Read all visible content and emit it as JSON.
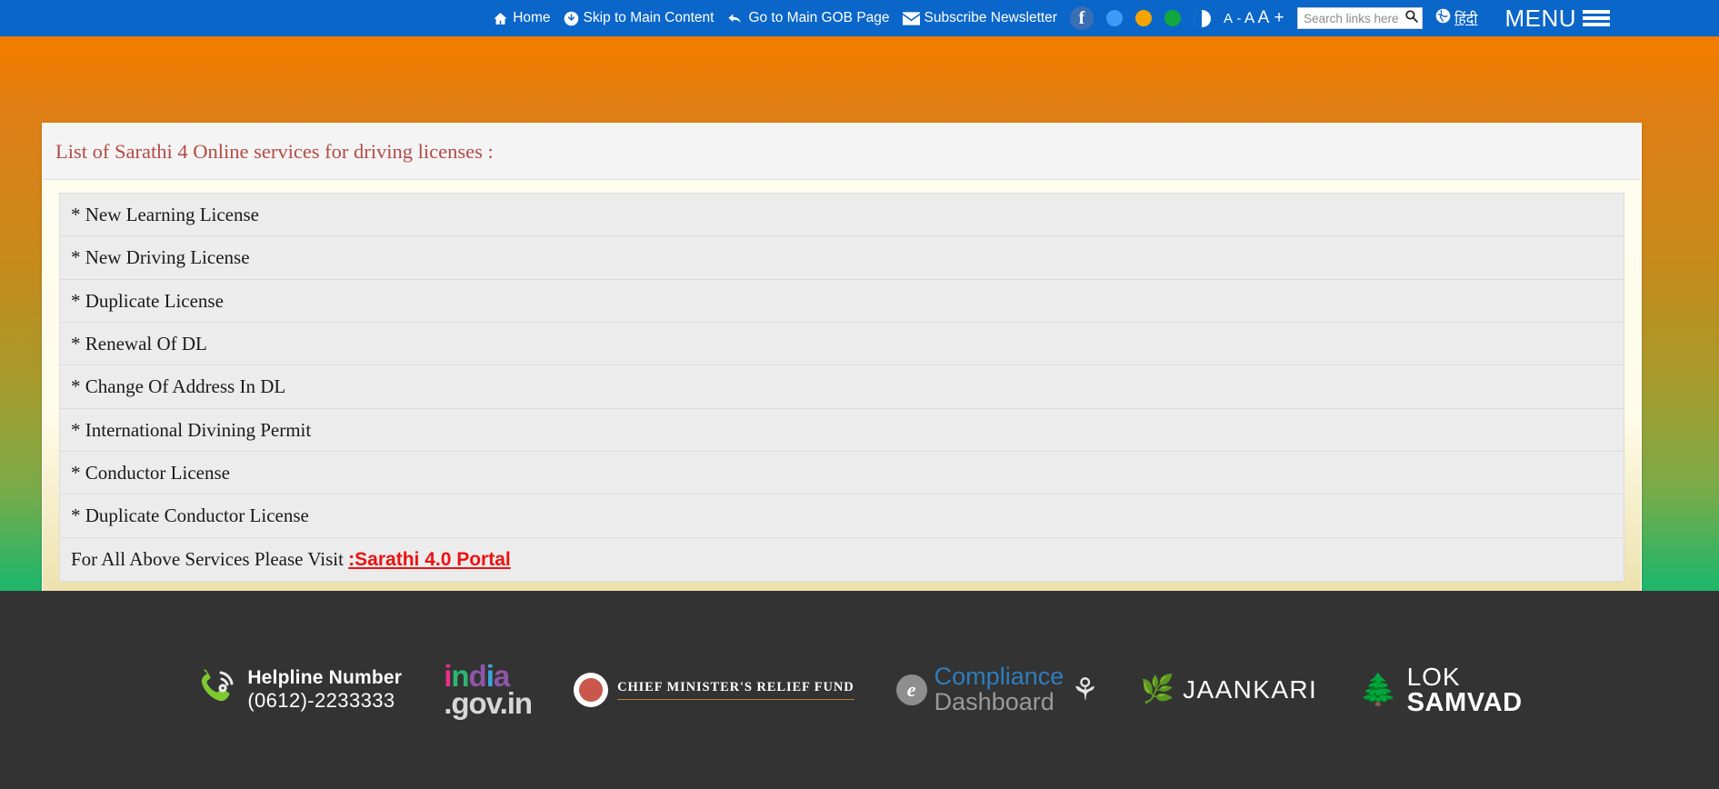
{
  "topbar": {
    "links": [
      {
        "label": "Home",
        "icon": "home-icon"
      },
      {
        "label": "Skip to Main Content",
        "icon": "skip-down-icon"
      },
      {
        "label": "Go to Main GOB Page",
        "icon": "back-arrow-icon"
      },
      {
        "label": "Subscribe Newsletter",
        "icon": "envelope-icon"
      }
    ],
    "facebook_label": "f",
    "theme_dots": [
      {
        "name": "blue",
        "color": "#3d9bf7"
      },
      {
        "name": "orange",
        "color": "#f7a400"
      },
      {
        "name": "green",
        "color": "#12a83d"
      }
    ],
    "contrast_icon": "contrast-icon",
    "font_decrease": "A -",
    "font_normal": "A",
    "font_increase": "A +",
    "search": {
      "placeholder": "Search links here",
      "value": "",
      "icon": "search-icon"
    },
    "language": {
      "label": "हिंदी",
      "icon": "globe-icon"
    },
    "menu": {
      "label": "MENU",
      "icon": "hamburger-icon"
    }
  },
  "panel": {
    "title": "List of Sarathi 4 Online services for driving licenses :",
    "services": [
      "* New Learning License",
      "* New Driving License",
      "* Duplicate License",
      "* Renewal Of DL",
      "* Change Of Address In DL",
      "* International Divining Permit",
      "* Conductor License",
      "* Duplicate Conductor License"
    ],
    "footer_note_prefix": "For All Above Services Please Visit ",
    "footer_note_link": ":Sarathi 4.0 Portal"
  },
  "footer": {
    "helpline": {
      "title": "Helpline Number",
      "number": "(0612)-2233333",
      "icon": "phone-icon"
    },
    "india_gov": {
      "part1": "i",
      "part2": "n",
      "part3": "d",
      "part4": "i",
      "part5": "a",
      "bottom": ".gov.in"
    },
    "cmrf": {
      "name": "CHIEF MINISTER'S RELIEF FUND",
      "icon": "cmrf-seal-icon"
    },
    "compliance": {
      "e": "e",
      "line1": "Compliance",
      "line2": "Dashboard",
      "emblem": "ashoka-emblem-icon"
    },
    "jaankari": {
      "label": "JAANKARI",
      "icon": "flame-icon"
    },
    "lok_samvad": {
      "line1": "LOK",
      "line2": "SAMVAD",
      "icon": "tree-emblem-icon"
    }
  },
  "colors": {
    "topbar_blue": "#0b66ca",
    "background_orange": "#f07c00",
    "background_green": "#10b86c",
    "title_red": "#b44a46",
    "link_red": "#ee1111",
    "footer_dark": "#333333"
  }
}
